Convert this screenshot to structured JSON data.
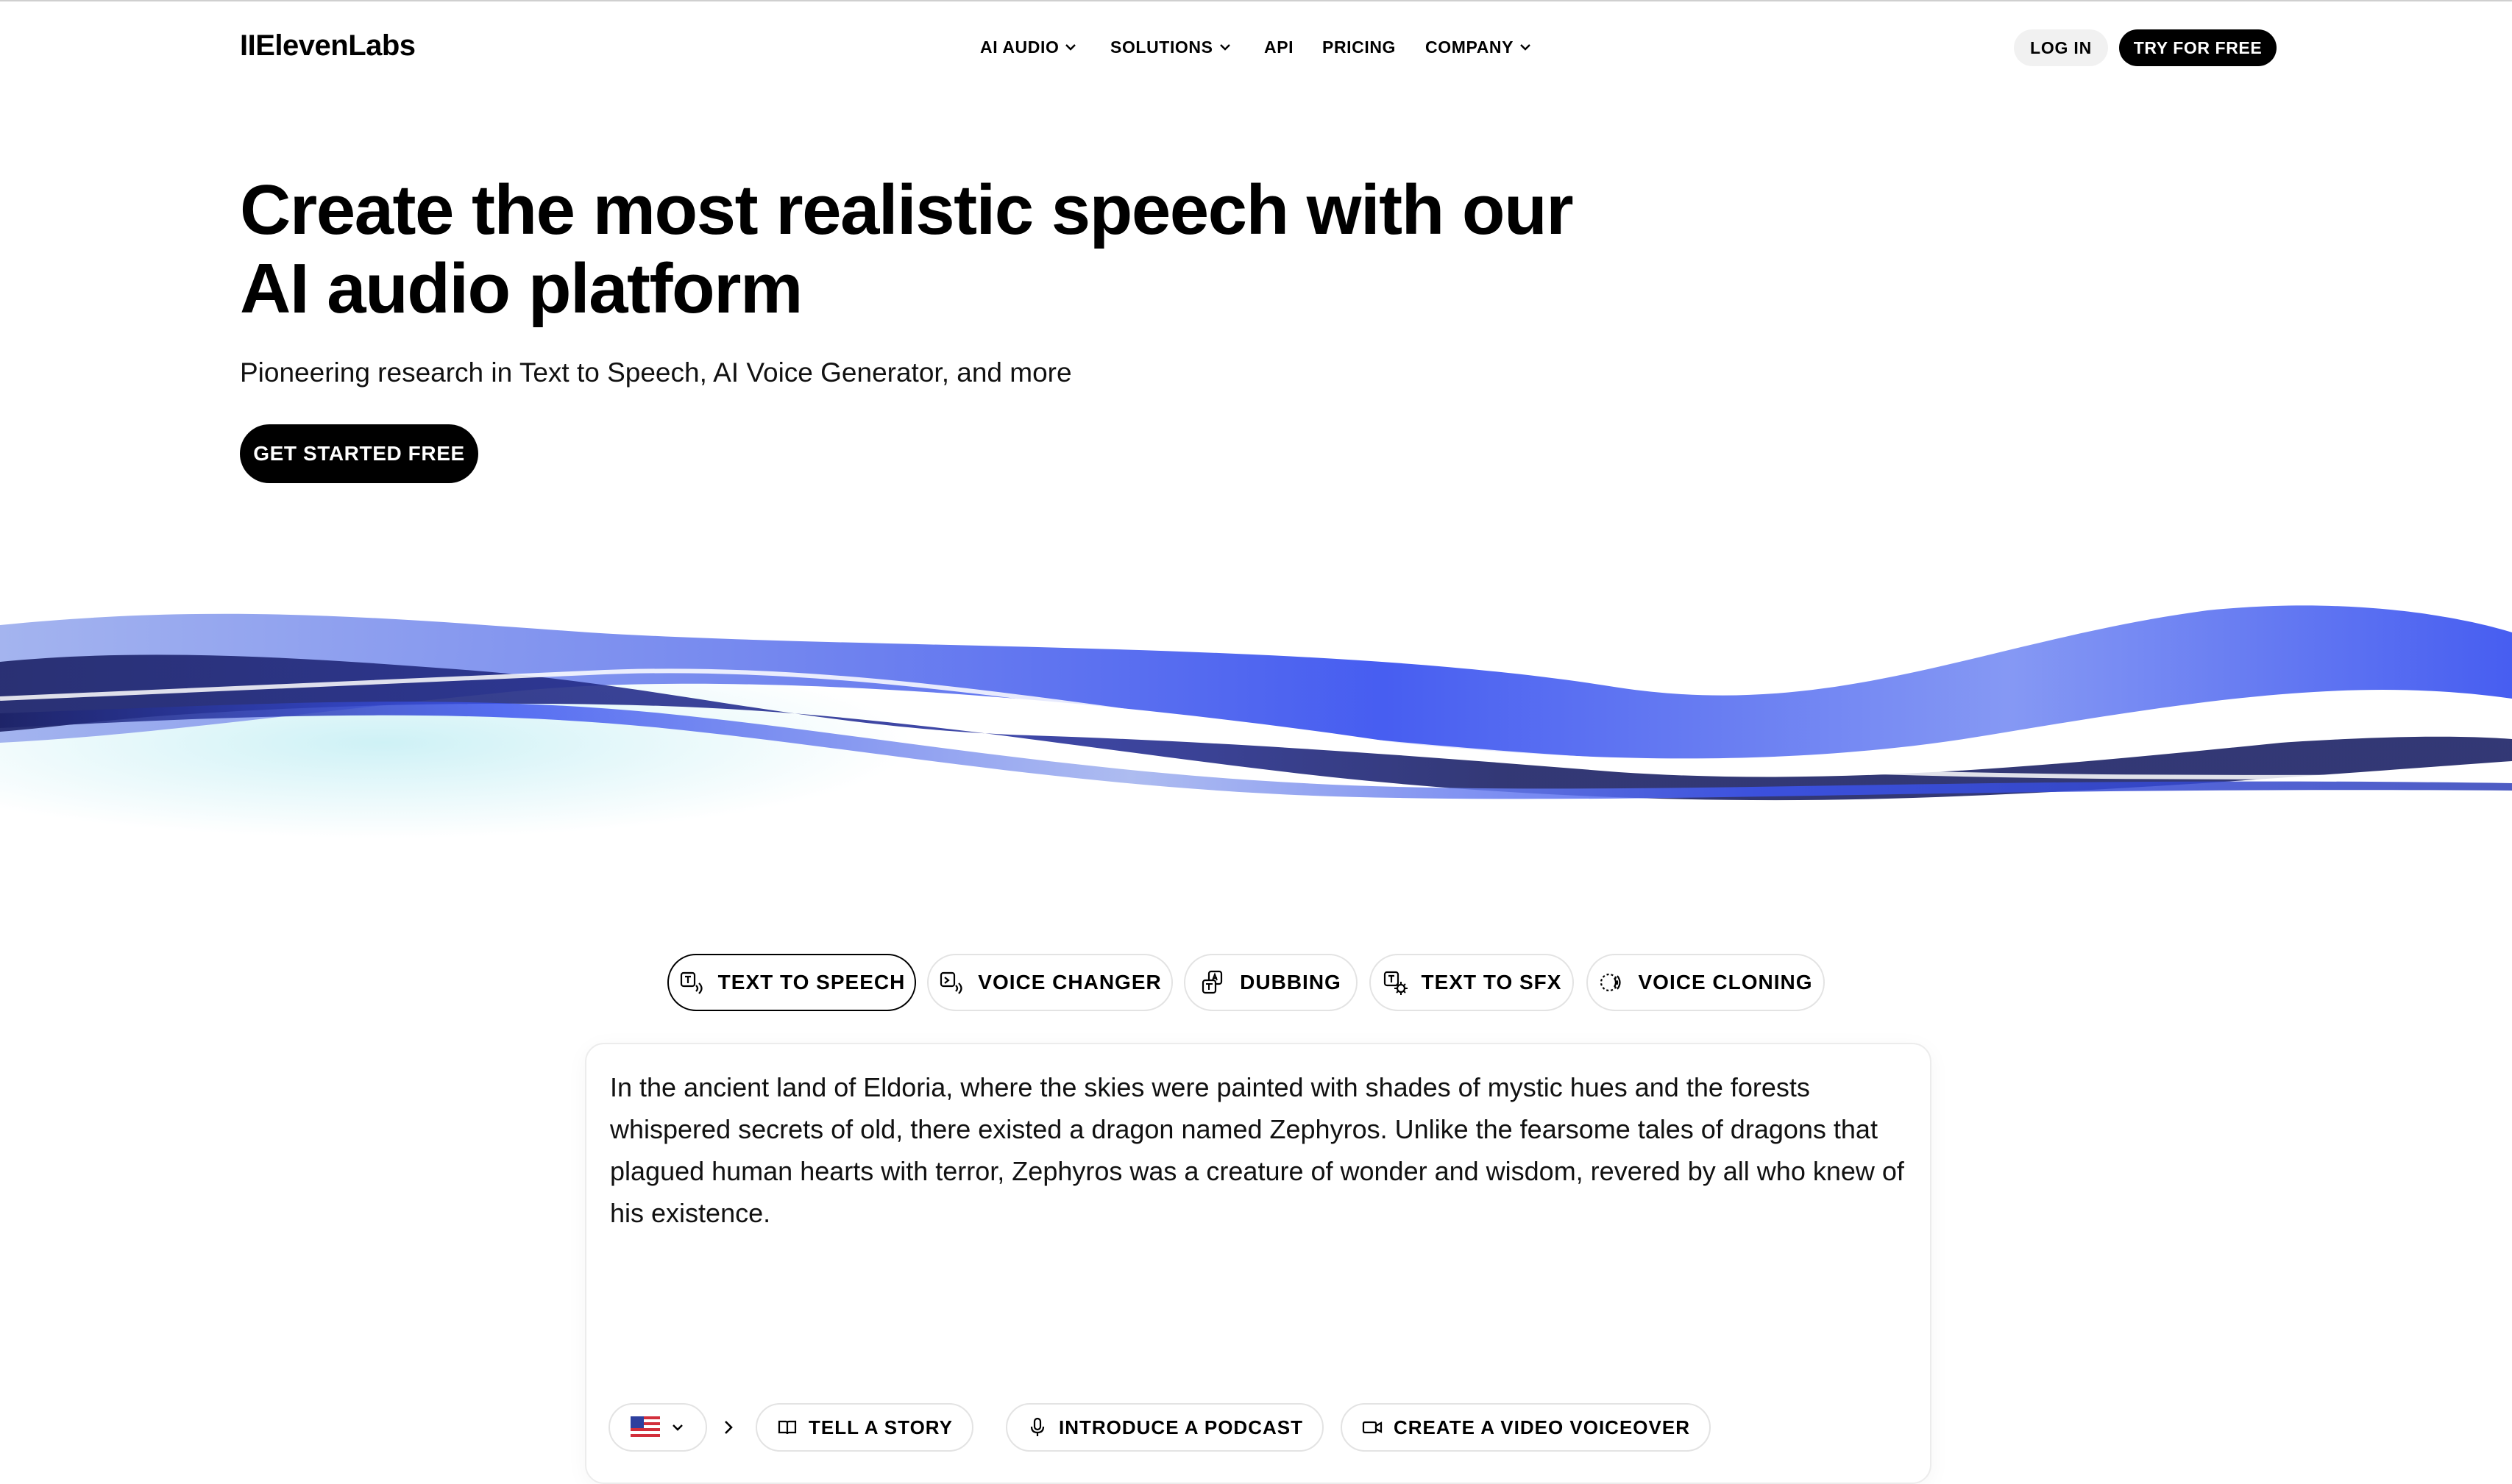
{
  "brand": {
    "logo": "IIElevenLabs"
  },
  "nav": {
    "items": [
      {
        "label": "AI AUDIO",
        "has_dropdown": true
      },
      {
        "label": "SOLUTIONS",
        "has_dropdown": true
      },
      {
        "label": "API",
        "has_dropdown": false
      },
      {
        "label": "PRICING",
        "has_dropdown": false
      },
      {
        "label": "COMPANY",
        "has_dropdown": true
      }
    ],
    "login_label": "LOG IN",
    "try_label": "TRY FOR FREE"
  },
  "hero": {
    "title": "Create the most realistic speech with our AI audio platform",
    "subtitle": "Pioneering research in Text to Speech, AI Voice Generator, and more",
    "cta_label": "GET STARTED FREE"
  },
  "tabs": [
    {
      "label": "TEXT TO SPEECH",
      "icon": "text-to-speech-icon",
      "active": true
    },
    {
      "label": "VOICE CHANGER",
      "icon": "voice-changer-icon",
      "active": false
    },
    {
      "label": "DUBBING",
      "icon": "dubbing-icon",
      "active": false
    },
    {
      "label": "TEXT TO SFX",
      "icon": "sfx-icon",
      "active": false
    },
    {
      "label": "VOICE CLONING",
      "icon": "voice-cloning-icon",
      "active": false
    }
  ],
  "panel": {
    "text": "In the ancient land of Eldoria, where the skies were painted with shades of mystic hues and the forests whispered secrets of old, there existed a dragon named Zephyros. Unlike the fearsome tales of dragons that plagued human hearts with terror, Zephyros was a creature of wonder and wisdom, revered by all who knew of his existence.",
    "language_icon": "us-flag-icon",
    "suggestions": [
      {
        "label": "TELL A STORY",
        "icon": "book-icon"
      },
      {
        "label": "INTRODUCE A PODCAST",
        "icon": "microphone-icon"
      },
      {
        "label": "CREATE A VIDEO VOICEOVER",
        "icon": "video-icon"
      }
    ]
  },
  "colors": {
    "accent": "#3d55f0",
    "dark_wave": "#1c2266",
    "light_wave": "#9fb0ee",
    "glow": "#c9f0f5"
  }
}
